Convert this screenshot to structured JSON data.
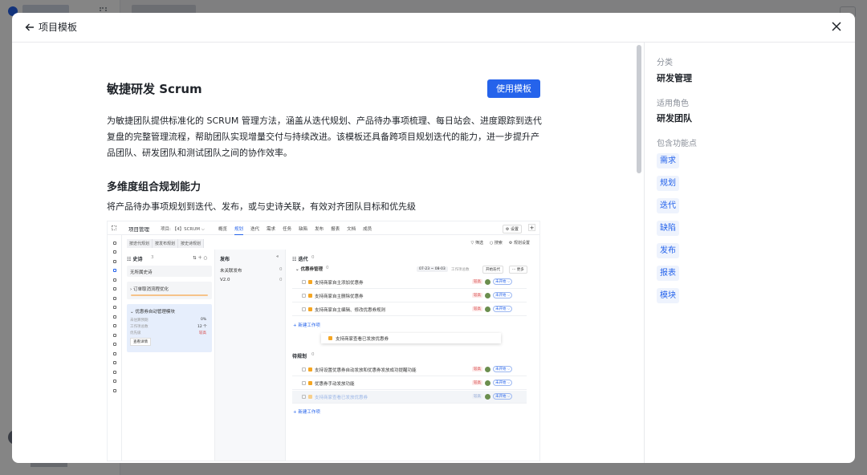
{
  "modal": {
    "back_label": "项目模板",
    "close_icon": "close-icon"
  },
  "template": {
    "title": "敏捷研发 Scrum",
    "use_button": "使用模板",
    "description": "为敏捷团队提供标准化的 SCRUM 管理方法，涵盖从迭代规划、产品待办事项梳理、每日站会、进度跟踪到迭代复盘的完整管理流程，帮助团队实现增量交付与持续改进。该模板还具备跨项目规划迭代的能力，进一步提升产品团队、研发团队和测试团队之间的协作效率。",
    "section_title": "多维度组合规划能力",
    "section_desc": "将产品待办事项规划到迭代、发布，或与史诗关联，有效对齐团队目标和优先级"
  },
  "preview": {
    "app_title": "项目管理",
    "project": "项目: 【4】SCRUM ⌵",
    "tabs": [
      "概览",
      "规划",
      "迭代",
      "需求",
      "任务",
      "缺陷",
      "发布",
      "报表",
      "文档",
      "成员"
    ],
    "active_tab": "规划",
    "settings": "⚙ 设置",
    "filters": [
      "按迭代规划",
      "按发布规划",
      "按史诗规划"
    ],
    "tools": [
      "▽ 筛选",
      "○ 搜索",
      "⚙ 规划设置"
    ],
    "epic": {
      "header": "☷ 史诗",
      "count": "3",
      "no_epic": "无所属史诗",
      "card1": "› 订单取消流程优化",
      "card2": "⌄ 优惠券自动管理模块",
      "stat1_label": "未估算预期",
      "stat1_value": "0%",
      "stat2_label": "工作项总数",
      "stat2_value": "12 个",
      "stat3_label": "优先级",
      "stat3_value": "较高",
      "detail_btn": "查看详情"
    },
    "release": {
      "header": "发布",
      "collapse": "«",
      "items": [
        {
          "name": "未关联发布",
          "count": "0"
        },
        {
          "name": "V2.0",
          "count": "0"
        }
      ]
    },
    "sprint": {
      "header": "☷ 迭代",
      "count": "0",
      "group": "⌄ 优惠券管理",
      "group_count": "0",
      "date": "07-23 ~ 08-03",
      "capacity": "工作项总数",
      "start_btn": "开始迭代",
      "more_btn": "··· 更多",
      "rows": [
        {
          "name": "支持商家自主添加优惠券",
          "tag": "较高",
          "status": "未开始 ⌵"
        },
        {
          "name": "支持商家自主删除优惠券",
          "tag": "较高",
          "status": "未开始 ⌵"
        },
        {
          "name": "支持商家自主编辑、修改优惠券规则",
          "tag": "较高",
          "status": "未开始 ⌵"
        }
      ],
      "add": "+ 新建工作项",
      "drag_item": "支持商家查看已发放优惠券"
    },
    "backlog": {
      "header": "待规划",
      "count": "0",
      "rows": [
        {
          "name": "支持设置优惠券自动发放和优惠券发放成功提醒功能",
          "tag": "较高",
          "status": "未开始 ⌵"
        },
        {
          "name": "优惠券手动发放功能",
          "tag": "较高",
          "status": "未开始 ⌵"
        },
        {
          "name": "支持商家查看已发放优惠券",
          "tag": "较高",
          "status": "未开始 ⌵"
        }
      ],
      "add": "+ 新建工作项"
    }
  },
  "side": {
    "category_label": "分类",
    "category_value": "研发管理",
    "role_label": "适用角色",
    "role_value": "研发团队",
    "features_label": "包含功能点",
    "features": [
      "需求",
      "规划",
      "迭代",
      "缺陷",
      "发布",
      "报表",
      "模块"
    ]
  },
  "colors": {
    "accent": "#2563eb",
    "feature_bg": "#eef3fd"
  }
}
